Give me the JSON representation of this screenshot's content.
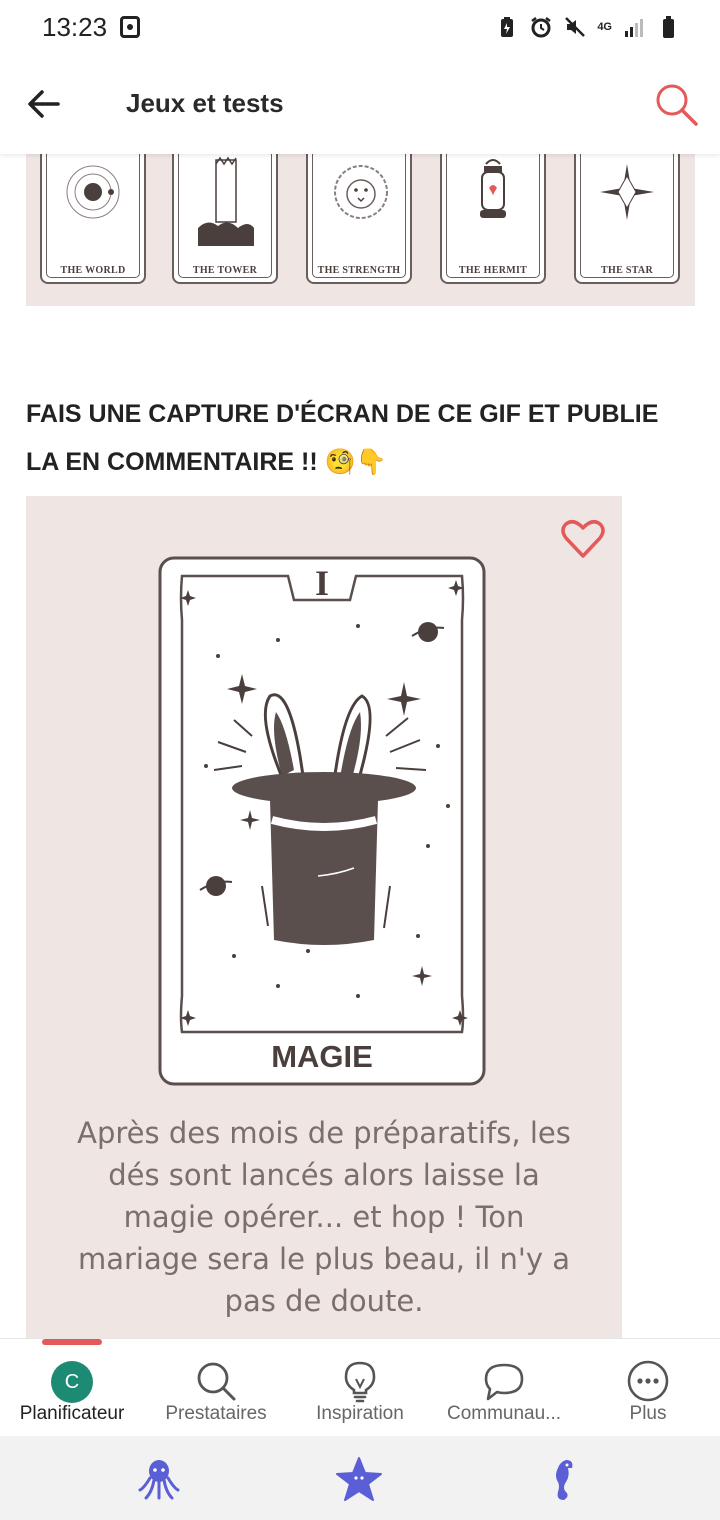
{
  "status_bar": {
    "time": "13:23",
    "network": "4G",
    "icons": [
      "screenshot-icon",
      "battery-saver-icon",
      "alarm-icon",
      "mute-icon",
      "signal-icon",
      "battery-icon"
    ]
  },
  "app_bar": {
    "title": "Jeux et tests",
    "back_icon": "arrow-left-icon",
    "search_icon": "search-icon"
  },
  "tarot_strip": {
    "cards": [
      {
        "label": "THE WORLD"
      },
      {
        "label": "THE TOWER"
      },
      {
        "label": "THE STRENGTH"
      },
      {
        "label": "THE HERMIT"
      },
      {
        "label": "THE STAR"
      }
    ]
  },
  "post": {
    "title": "FAIS UNE CAPTURE D'ÉCRAN DE CE GIF ET PUBLIE LA EN COMMENTAIRE !! 🧐👇",
    "card": {
      "roman": "I",
      "name": "MAGIE",
      "caption": "Après des mois de préparatifs, les dés sont lancés alors laisse la magie opérer... et hop ! Ton mariage sera le plus beau, il n'y a pas de doute."
    }
  },
  "tabs": [
    {
      "label": "Planificateur",
      "icon": "avatar-c",
      "avatar_letter": "C",
      "active": true
    },
    {
      "label": "Prestataires",
      "icon": "search-icon"
    },
    {
      "label": "Inspiration",
      "icon": "lightbulb-icon"
    },
    {
      "label": "Communau...",
      "icon": "chat-bubble-icon"
    },
    {
      "label": "Plus",
      "icon": "more-icon"
    }
  ],
  "colors": {
    "accent": "#e45a5a",
    "card_bg": "#efe5e3",
    "ink": "#4a3f3d",
    "avatar": "#1d8a74",
    "sys_nav_icons": "#5a5fd6"
  },
  "system_nav": {
    "icons": [
      "octopus-icon",
      "starfish-icon",
      "seahorse-icon"
    ]
  }
}
